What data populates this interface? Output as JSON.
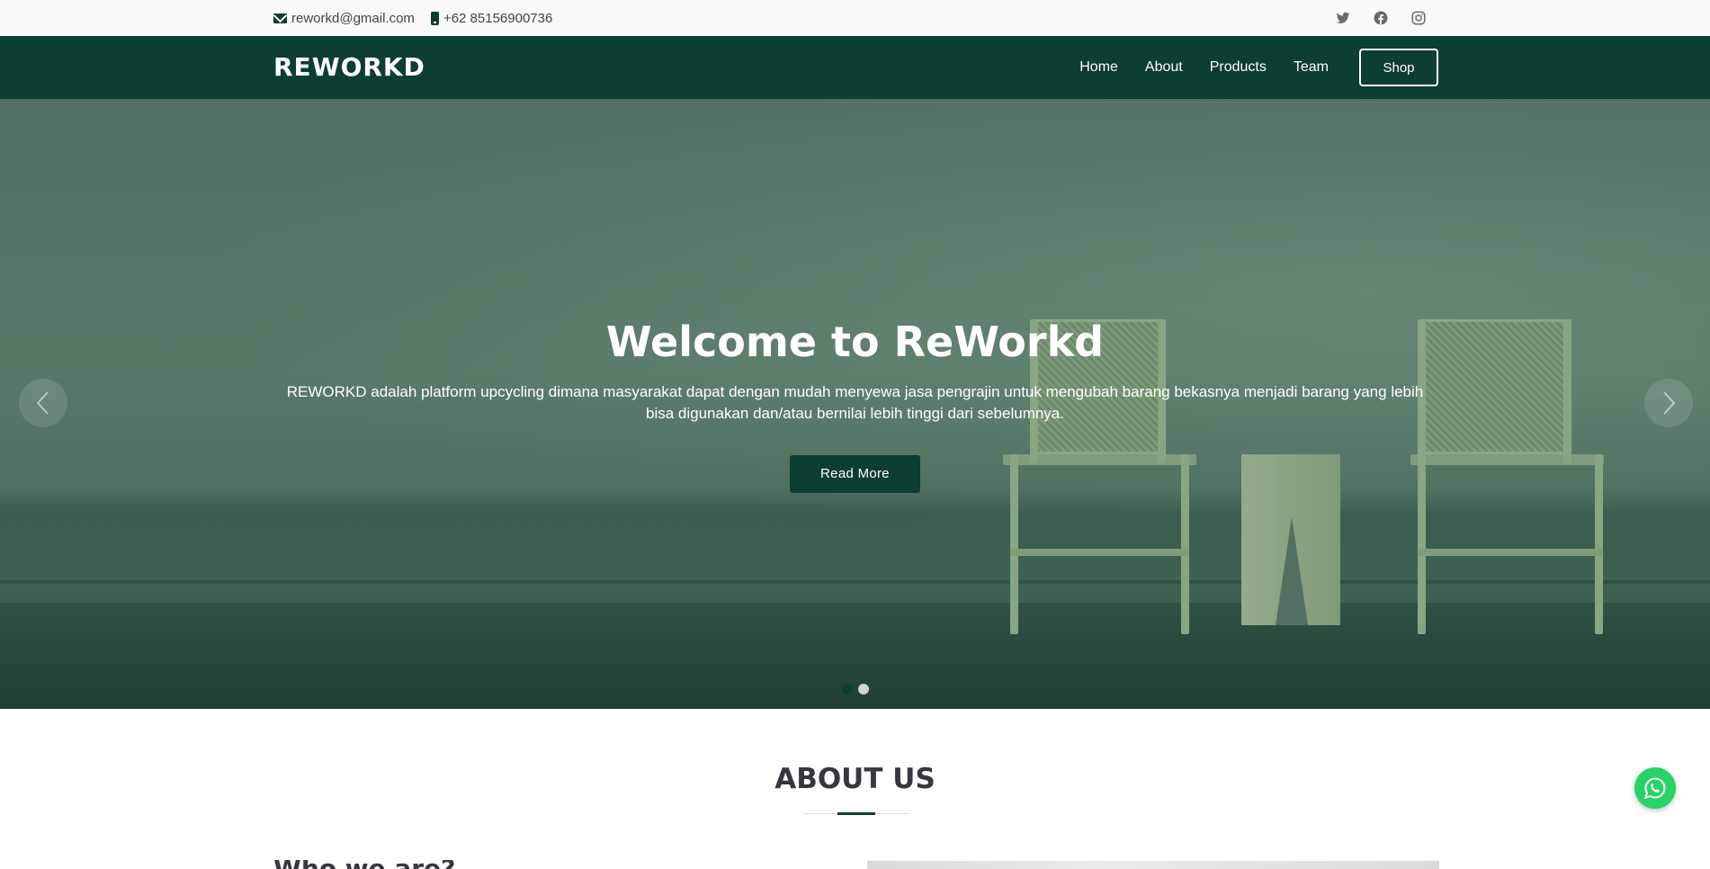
{
  "topbar": {
    "email": "reworkd@gmail.com",
    "phone": "+62 85156900736",
    "icons": [
      "mail-icon",
      "phone-icon",
      "twitter-icon",
      "facebook-icon",
      "instagram-icon"
    ]
  },
  "header": {
    "logo": "REWORKD",
    "nav": [
      "Home",
      "About",
      "Products",
      "Team"
    ],
    "shop_label": "Shop"
  },
  "hero": {
    "title": "Welcome to ReWorkd",
    "text": "REWORKD adalah platform upcycling dimana masyarakat dapat dengan mudah menyewa jasa pengrajin untuk mengubah barang bekasnya menjadi barang yang lebih bisa digunakan dan/atau bernilai lebih tinggi dari sebelumnya.",
    "button_label": "Read More",
    "slide_count": 2,
    "active_slide": 1
  },
  "about": {
    "title": "ABOUT US",
    "heading_peek": "Who we are?"
  },
  "colors": {
    "primary": "#0c3e32",
    "topbar_bg": "#f9f9f9",
    "whatsapp": "#25d366"
  }
}
